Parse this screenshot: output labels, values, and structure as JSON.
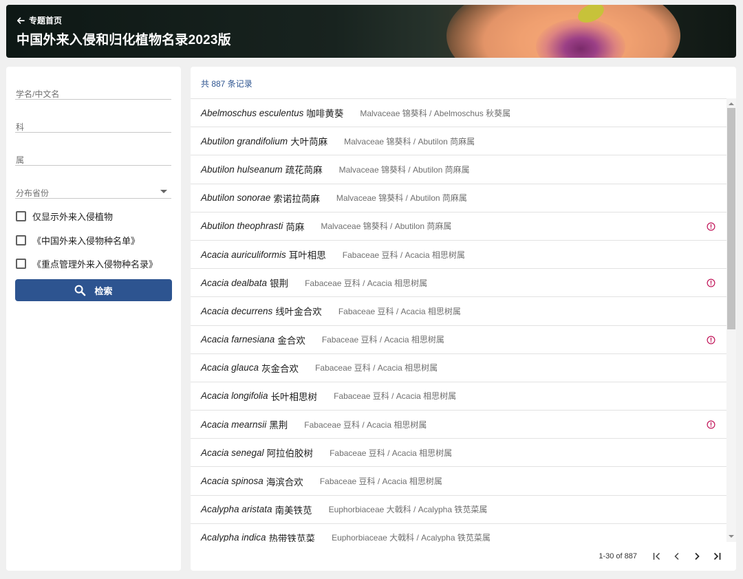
{
  "header": {
    "back_label": "专题首页",
    "title": "中国外来入侵和归化植物名录2023版"
  },
  "filters": {
    "name_label": "学名/中文名",
    "family_label": "科",
    "genus_label": "属",
    "province_label": "分布省份",
    "checkboxes": [
      "仅显示外来入侵植物",
      "《中国外来入侵物种名单》",
      "《重点管理外来入侵物种名录》"
    ],
    "search_label": "检索"
  },
  "results": {
    "count_text": "共 887 条记录",
    "rows": [
      {
        "sci": "Abelmoschus esculentus",
        "cn": "咖啡黄葵",
        "fam": "Malvaceae 锦葵科 / Abelmoschus 秋葵属",
        "alert": false
      },
      {
        "sci": "Abutilon grandifolium",
        "cn": "大叶苘麻",
        "fam": "Malvaceae 锦葵科 / Abutilon 苘麻属",
        "alert": false
      },
      {
        "sci": "Abutilon hulseanum",
        "cn": "疏花苘麻",
        "fam": "Malvaceae 锦葵科 / Abutilon 苘麻属",
        "alert": false
      },
      {
        "sci": "Abutilon sonorae",
        "cn": "索诺拉苘麻",
        "fam": "Malvaceae 锦葵科 / Abutilon 苘麻属",
        "alert": false
      },
      {
        "sci": "Abutilon theophrasti",
        "cn": "苘麻",
        "fam": "Malvaceae 锦葵科 / Abutilon 苘麻属",
        "alert": true
      },
      {
        "sci": "Acacia auriculiformis",
        "cn": "耳叶相思",
        "fam": "Fabaceae 豆科 / Acacia 相思树属",
        "alert": false
      },
      {
        "sci": "Acacia dealbata",
        "cn": "银荆",
        "fam": "Fabaceae 豆科 / Acacia 相思树属",
        "alert": true
      },
      {
        "sci": "Acacia decurrens",
        "cn": "线叶金合欢",
        "fam": "Fabaceae 豆科 / Acacia 相思树属",
        "alert": false
      },
      {
        "sci": "Acacia farnesiana",
        "cn": "金合欢",
        "fam": "Fabaceae 豆科 / Acacia 相思树属",
        "alert": true
      },
      {
        "sci": "Acacia glauca",
        "cn": "灰金合欢",
        "fam": "Fabaceae 豆科 / Acacia 相思树属",
        "alert": false
      },
      {
        "sci": "Acacia longifolia",
        "cn": "长叶相思树",
        "fam": "Fabaceae 豆科 / Acacia 相思树属",
        "alert": false
      },
      {
        "sci": "Acacia mearnsii",
        "cn": "黑荆",
        "fam": "Fabaceae 豆科 / Acacia 相思树属",
        "alert": true
      },
      {
        "sci": "Acacia senegal",
        "cn": "阿拉伯胶树",
        "fam": "Fabaceae 豆科 / Acacia 相思树属",
        "alert": false
      },
      {
        "sci": "Acacia spinosa",
        "cn": "海滨合欢",
        "fam": "Fabaceae 豆科 / Acacia 相思树属",
        "alert": false
      },
      {
        "sci": "Acalypha aristata",
        "cn": "南美铁苋",
        "fam": "Euphorbiaceae 大戟科 / Acalypha 铁苋菜属",
        "alert": false
      },
      {
        "sci": "Acalypha indica",
        "cn": "热带铁苋菜",
        "fam": "Euphorbiaceae 大戟科 / Acalypha 铁苋菜属",
        "alert": false
      }
    ],
    "pagination": {
      "range_text": "1-30 of 887"
    },
    "colors": {
      "accent": "#2d5490",
      "alert": "#c2185b"
    }
  }
}
